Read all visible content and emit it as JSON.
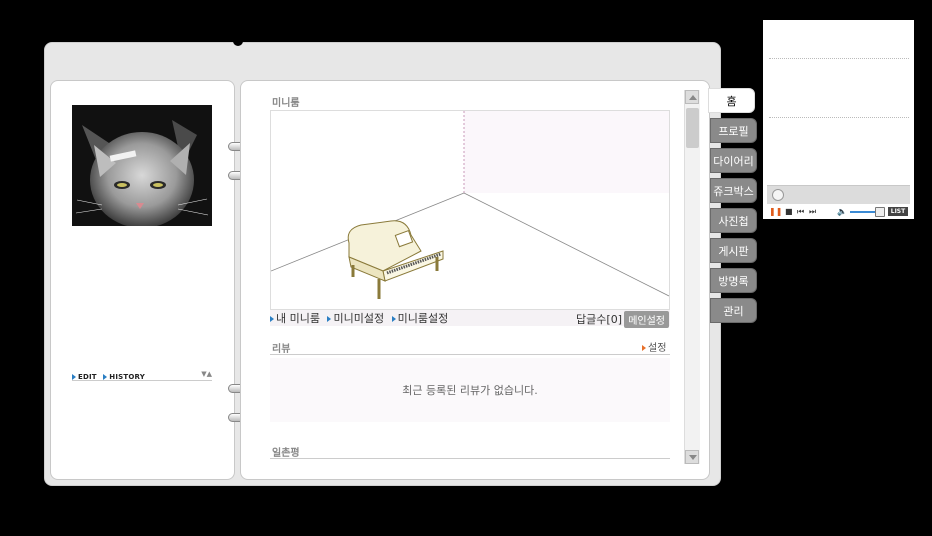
{
  "profile": {
    "edit_label": "EDIT",
    "history_label": "HISTORY"
  },
  "miniroom": {
    "title": "미니룸",
    "links": [
      "내 미니룸",
      "미니미설정",
      "미니룸설정"
    ],
    "reply_count_label": "답글수[0]",
    "main_setting_label": "메인설정"
  },
  "review": {
    "title": "리뷰",
    "setting_label": "설정",
    "empty_message": "최근 등록된 리뷰가 없습니다."
  },
  "ilchon": {
    "title": "일촌평"
  },
  "tabs": [
    {
      "label": "홈",
      "active": true
    },
    {
      "label": "프로필",
      "active": false
    },
    {
      "label": "다이어리",
      "active": false
    },
    {
      "label": "쥬크박스",
      "active": false
    },
    {
      "label": "사진첩",
      "active": false
    },
    {
      "label": "게시판",
      "active": false
    },
    {
      "label": "방명록",
      "active": false
    },
    {
      "label": "관리",
      "active": false
    }
  ],
  "player": {
    "list_label": "LIST"
  },
  "colors": {
    "background": "#000000",
    "tab_inactive": "#8a8a8a",
    "link_arrow_blue": "#2a7ec3",
    "link_arrow_orange": "#e8702a"
  }
}
